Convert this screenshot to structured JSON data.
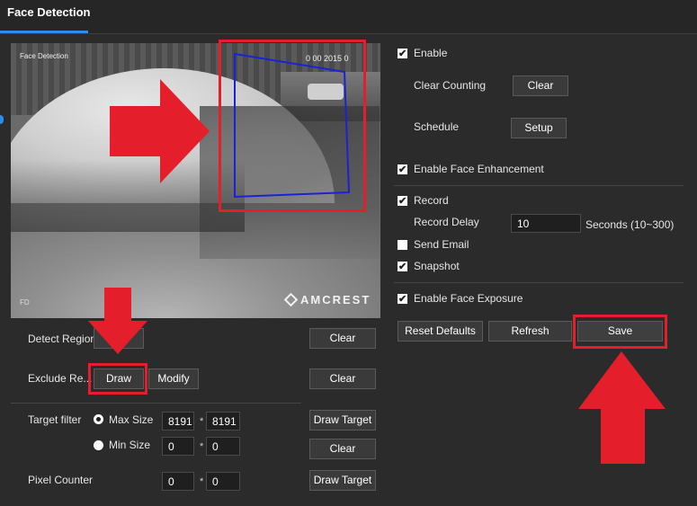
{
  "header": {
    "tab_label": "Face Detection"
  },
  "video": {
    "overlay_label": "Face Detection",
    "timestamp": "0 00 2015 0",
    "brand": "AMCREST",
    "corner_label": "FD"
  },
  "left": {
    "detect_region_label": "Detect Region",
    "exclude_region_label": "Exclude Re...",
    "draw_label": "Draw",
    "modify_label": "Modify",
    "clear_label": "Clear",
    "target_filter_label": "Target filter",
    "max_size_label": "Max Size",
    "min_size_label": "Min Size",
    "max_w": "8191",
    "max_h": "8191",
    "min_w": "0",
    "min_h": "0",
    "star": "*",
    "draw_target_label": "Draw Target",
    "pixel_counter_label": "Pixel Counter",
    "pixel_w": "0",
    "pixel_h": "0"
  },
  "right": {
    "enable_label": "Enable",
    "clear_counting_label": "Clear Counting",
    "clear_label": "Clear",
    "schedule_label": "Schedule",
    "setup_label": "Setup",
    "enable_face_enhancement_label": "Enable Face Enhancement",
    "record_label": "Record",
    "record_delay_label": "Record Delay",
    "record_delay_value": "10",
    "record_delay_unit": "Seconds (10~300)",
    "send_email_label": "Send Email",
    "snapshot_label": "Snapshot",
    "enable_face_exposure_label": "Enable Face Exposure",
    "reset_defaults_label": "Reset Defaults",
    "refresh_label": "Refresh",
    "save_label": "Save",
    "check_mark": "✔"
  },
  "state": {
    "enable": true,
    "enable_face_enhancement": true,
    "record": true,
    "send_email": false,
    "snapshot": true,
    "enable_face_exposure": true,
    "target_filter": "max_size"
  },
  "colors": {
    "accent": "#2a8ee8",
    "annotation_red": "#e41f2b",
    "region_blue": "#1a22d6"
  }
}
